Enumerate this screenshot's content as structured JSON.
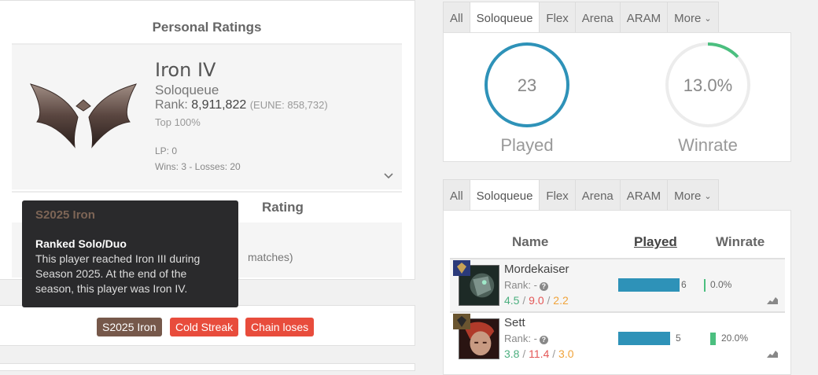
{
  "personal_ratings": {
    "title": "Personal Ratings",
    "tier": "Iron IV",
    "queue": "Soloqueue",
    "rank_label": "Rank:",
    "rank_value": "8,911,822",
    "region_rank": "(EUNE: 858,732)",
    "top_percent": "Top 100%",
    "lp": "LP: 0",
    "wins_losses": "Wins: 3 - Losses: 20"
  },
  "flex_section": {
    "title": "Rating",
    "subtitle": "matches)"
  },
  "tooltip": {
    "title": "S2025 Iron",
    "heading": "Ranked Solo/Duo",
    "body": "This player reached Iron III during Season 2025. At the end of the season, this player was Iron IV."
  },
  "tags": [
    "S2025 Iron",
    "Cold Streak",
    "Chain loses"
  ],
  "colors": {
    "tag_brown": "#76584a",
    "tag_red": "#e84c3c",
    "accent_blue": "#2e92b8",
    "accent_green": "#4bbf7f"
  },
  "queue_tabs_top": {
    "items": [
      "All",
      "Soloqueue",
      "Flex",
      "Arena",
      "ARAM",
      "More"
    ],
    "active": "Soloqueue"
  },
  "stats": {
    "played": {
      "value": "23",
      "label": "Played"
    },
    "winrate": {
      "value": "13.0%",
      "label": "Winrate",
      "fraction": 0.13
    }
  },
  "queue_tabs_bottom": {
    "items": [
      "All",
      "Soloqueue",
      "Flex",
      "Arena",
      "ARAM",
      "More"
    ],
    "active": "Soloqueue"
  },
  "champions_table": {
    "headers": {
      "name": "Name",
      "played": "Played",
      "winrate": "Winrate"
    },
    "rows": [
      {
        "name": "Mordekaiser",
        "rank": "Rank: -",
        "kills": "4.5",
        "deaths": "9.0",
        "assists": "2.2",
        "played": "6",
        "played_fraction": 0.26,
        "winrate": "0.0%",
        "icon": "mordekaiser-portrait"
      },
      {
        "name": "Sett",
        "rank": "Rank: -",
        "kills": "3.8",
        "deaths": "11.4",
        "assists": "3.0",
        "played": "5",
        "played_fraction": 0.22,
        "winrate": "20.0%",
        "icon": "sett-portrait"
      }
    ]
  }
}
